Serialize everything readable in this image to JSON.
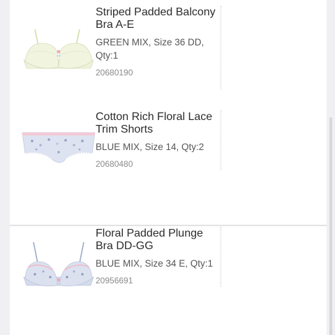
{
  "items": [
    {
      "title": "Striped Padded Balcony Bra A-E",
      "variant": "GREEN MIX, Size 36 DD, Qty:1",
      "sku": "20680190",
      "image_icon": "striped-balcony-bra-image"
    },
    {
      "title": "Cotton Rich Floral Lace Trim Shorts",
      "variant": "BLUE MIX, Size 14, Qty:2",
      "sku": "20680480",
      "image_icon": "floral-lace-shorts-image"
    },
    {
      "title": "Floral Padded Plunge Bra DD-GG",
      "variant": "BLUE MIX, Size 34 E, Qty:1",
      "sku": "20956691",
      "image_icon": "floral-plunge-bra-image"
    }
  ],
  "colors": {
    "background": "#f0f0f2",
    "card": "#ffffff",
    "title_text": "#2b2b2b",
    "variant_text": "#555555",
    "sku_text": "#8a8a8a"
  }
}
